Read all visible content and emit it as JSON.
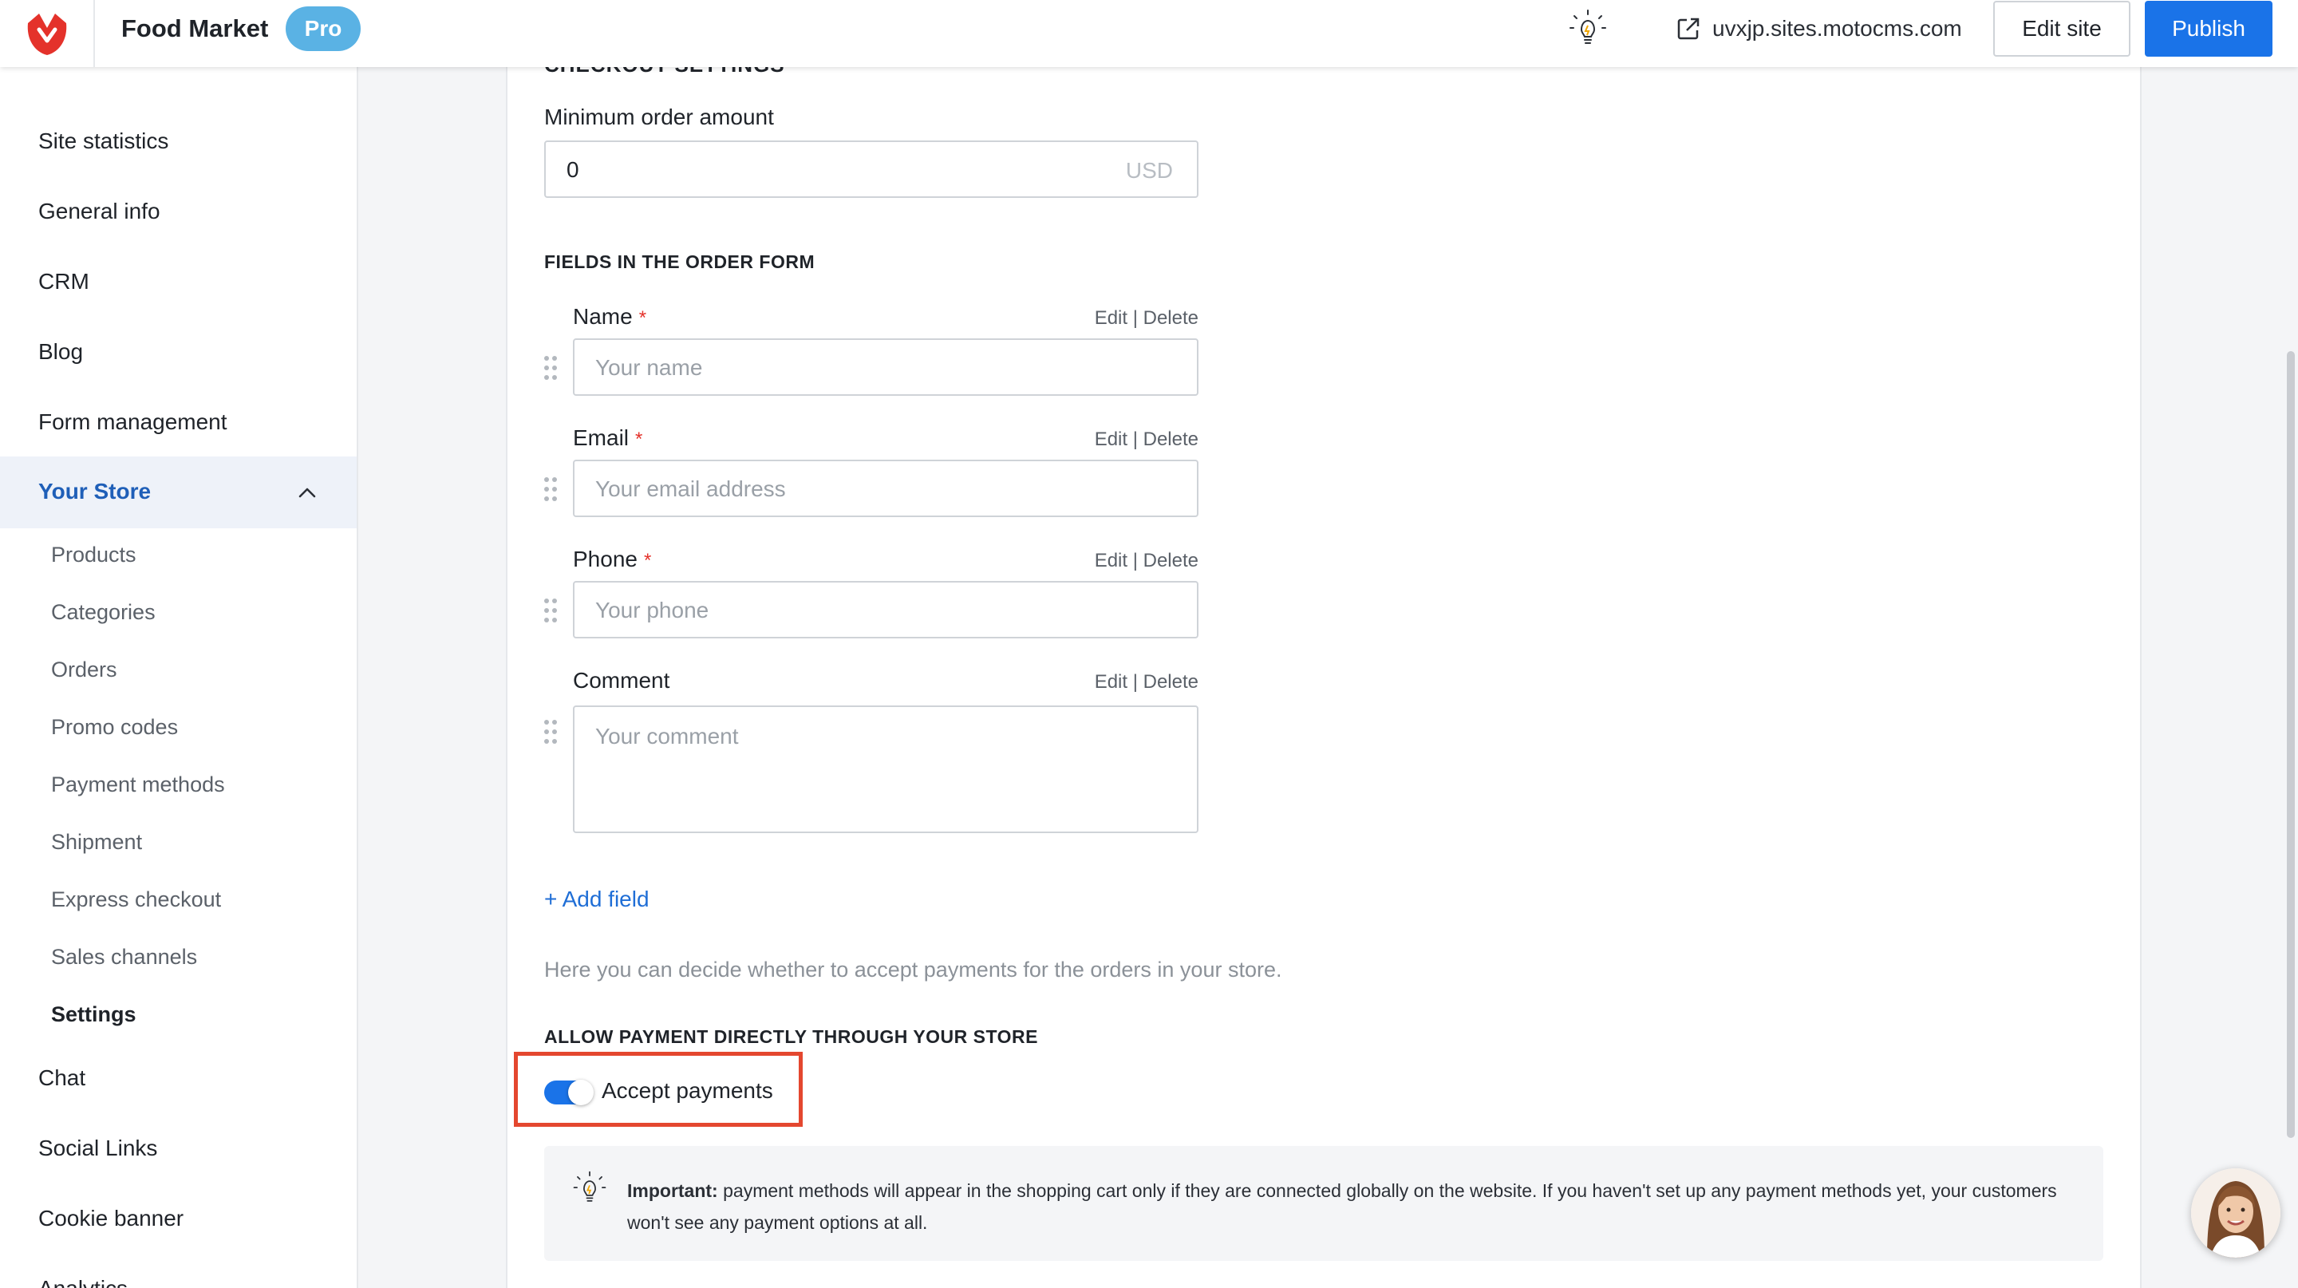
{
  "header": {
    "app_name": "Food Market",
    "plan_badge": "Pro",
    "site_url": "uvxjp.sites.motocms.com",
    "edit_site_label": "Edit site",
    "publish_label": "Publish"
  },
  "sidebar": {
    "items": [
      {
        "label": "Site statistics"
      },
      {
        "label": "General info"
      },
      {
        "label": "CRM"
      },
      {
        "label": "Blog"
      },
      {
        "label": "Form management"
      }
    ],
    "active_section": "Your Store",
    "store_items": [
      {
        "label": "Products"
      },
      {
        "label": "Categories"
      },
      {
        "label": "Orders"
      },
      {
        "label": "Promo codes"
      },
      {
        "label": "Payment methods"
      },
      {
        "label": "Shipment"
      },
      {
        "label": "Express checkout"
      },
      {
        "label": "Sales channels"
      },
      {
        "label": "Settings"
      }
    ],
    "bottom_items": [
      {
        "label": "Chat"
      },
      {
        "label": "Social Links"
      },
      {
        "label": "Cookie banner"
      },
      {
        "label": "Analytics"
      }
    ]
  },
  "main": {
    "cut_heading": "CHECKOUT SETTINGS",
    "min_order": {
      "label": "Minimum order amount",
      "value": "0",
      "unit": "USD"
    },
    "fields_title": "FIELDS IN THE ORDER FORM",
    "edit_label": "Edit",
    "separator": "|",
    "delete_label": "Delete",
    "required_mark": "*",
    "fields": [
      {
        "label": "Name",
        "placeholder": "Your name"
      },
      {
        "label": "Email",
        "placeholder": "Your email address"
      },
      {
        "label": "Phone",
        "placeholder": "Your phone"
      },
      {
        "label": "Comment",
        "placeholder": "Your comment"
      }
    ],
    "add_field_label": "+ Add field",
    "payments_help": "Here you can decide whether to accept payments for the orders in your store.",
    "payments_title": "ALLOW PAYMENT DIRECTLY THROUGH YOUR STORE",
    "accept_payments_label": "Accept payments",
    "accept_payments_on": true,
    "notice_bold": "Important:",
    "notice_text": " payment methods will appear in the shopping cart only if they are connected globally on the website. If you haven't set up any payment methods yet, your customers won't see any payment options at all."
  },
  "colors": {
    "accent": "#1a73e8",
    "active_nav": "#1f5fb8",
    "highlight": "#e4472f",
    "pro_badge": "#5ab2e4",
    "logo": "#e4322b"
  },
  "icons": [
    "brand-logo-icon",
    "lightbulb-icon",
    "external-link-icon",
    "chevron-up-icon",
    "drag-handle-icon",
    "support-avatar"
  ]
}
